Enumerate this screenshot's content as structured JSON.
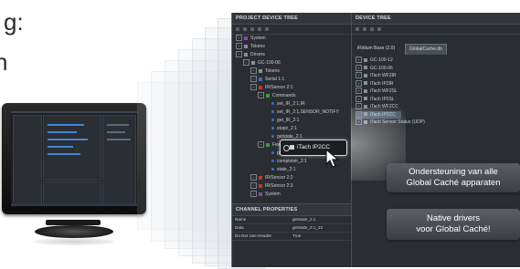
{
  "partial_text": {
    "line1": "g:",
    "line2": "n"
  },
  "project_tree": {
    "header": "PROJECT DEVICE TREE",
    "rows": [
      {
        "label": "System",
        "indent": 0
      },
      {
        "label": "Tokens",
        "indent": 0
      },
      {
        "label": "Drivers",
        "indent": 0
      },
      {
        "label": "GC-100-06",
        "indent": 1
      },
      {
        "label": "Tokens",
        "indent": 2
      },
      {
        "label": "Serial 1:1",
        "indent": 2
      },
      {
        "label": "IR/Sensor 2:1",
        "indent": 2
      },
      {
        "label": "Commands",
        "indent": 3
      },
      {
        "label": "set_IR_2:1,IR",
        "indent": 4
      },
      {
        "label": "set_IR_2:1,SENSOR_NOTIFY",
        "indent": 4
      },
      {
        "label": "get_IR_2:1",
        "indent": 4
      },
      {
        "label": "stopir_2:1",
        "indent": 4
      },
      {
        "label": "getstate_2:1",
        "indent": 4
      },
      {
        "label": "Feedback",
        "indent": 3
      },
      {
        "label": "get_IR_2:1,IR",
        "indent": 4
      },
      {
        "label": "completeir_2:1",
        "indent": 4
      },
      {
        "label": "state_2:1",
        "indent": 4
      },
      {
        "label": "IR/Sensor 2:2",
        "indent": 2
      },
      {
        "label": "IR/Sensor 2:3",
        "indent": 2
      },
      {
        "label": "System",
        "indent": 2
      }
    ]
  },
  "channel_properties": {
    "header": "CHANNEL PROPERTIES",
    "rows": [
      {
        "key": "Name",
        "value": "getstate_2:1"
      },
      {
        "key": "Data",
        "value": "getstate_2:1_13"
      },
      {
        "key": "Do Not Use Header",
        "value": "True"
      }
    ]
  },
  "device_tree": {
    "header": "DEVICE TREE",
    "tabs": [
      "iRidium Base (2.0)",
      "GlobalCache.db"
    ],
    "rows": [
      "GC-100-12",
      "GC-100-06",
      "iTach WF2IR",
      "iTach IP2IR",
      "iTach WF2SL",
      "iTach IP2SL",
      "iTach WF2CC",
      "iTach IP2CC",
      "iTach Sensor Status (UDP)"
    ],
    "selected_index": 7
  },
  "popup": {
    "label": "iTach IP2CC"
  },
  "callouts": {
    "support": {
      "line1": "Ondersteuning van alle",
      "line2": "Global Caché apparaten"
    },
    "drivers": {
      "line1": "Native drivers",
      "line2": "voor Global Caché!"
    }
  }
}
